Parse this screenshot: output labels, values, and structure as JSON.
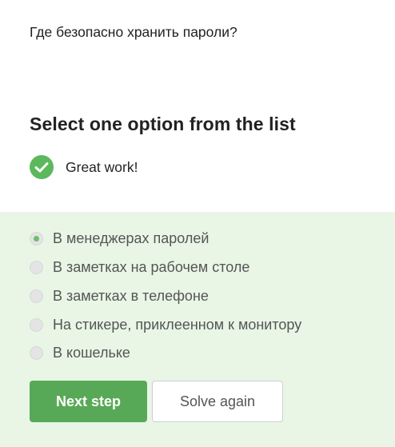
{
  "question": "Где безопасно хранить пароли?",
  "instruction": "Select one option from the list",
  "feedback": {
    "text": "Great work!",
    "icon": "checkmark-circle-icon",
    "color": "#5cb85c"
  },
  "options": [
    {
      "label": "В менеджерах паролей",
      "selected": true
    },
    {
      "label": "В заметках на рабочем столе",
      "selected": false
    },
    {
      "label": "В заметках в телефоне",
      "selected": false
    },
    {
      "label": "На стикере, приклеенном к монитору",
      "selected": false
    },
    {
      "label": "В кошельке",
      "selected": false
    }
  ],
  "buttons": {
    "next_label": "Next step",
    "solve_again_label": "Solve again"
  },
  "colors": {
    "accent": "#58a957",
    "panel_background": "#e9f6e6"
  }
}
